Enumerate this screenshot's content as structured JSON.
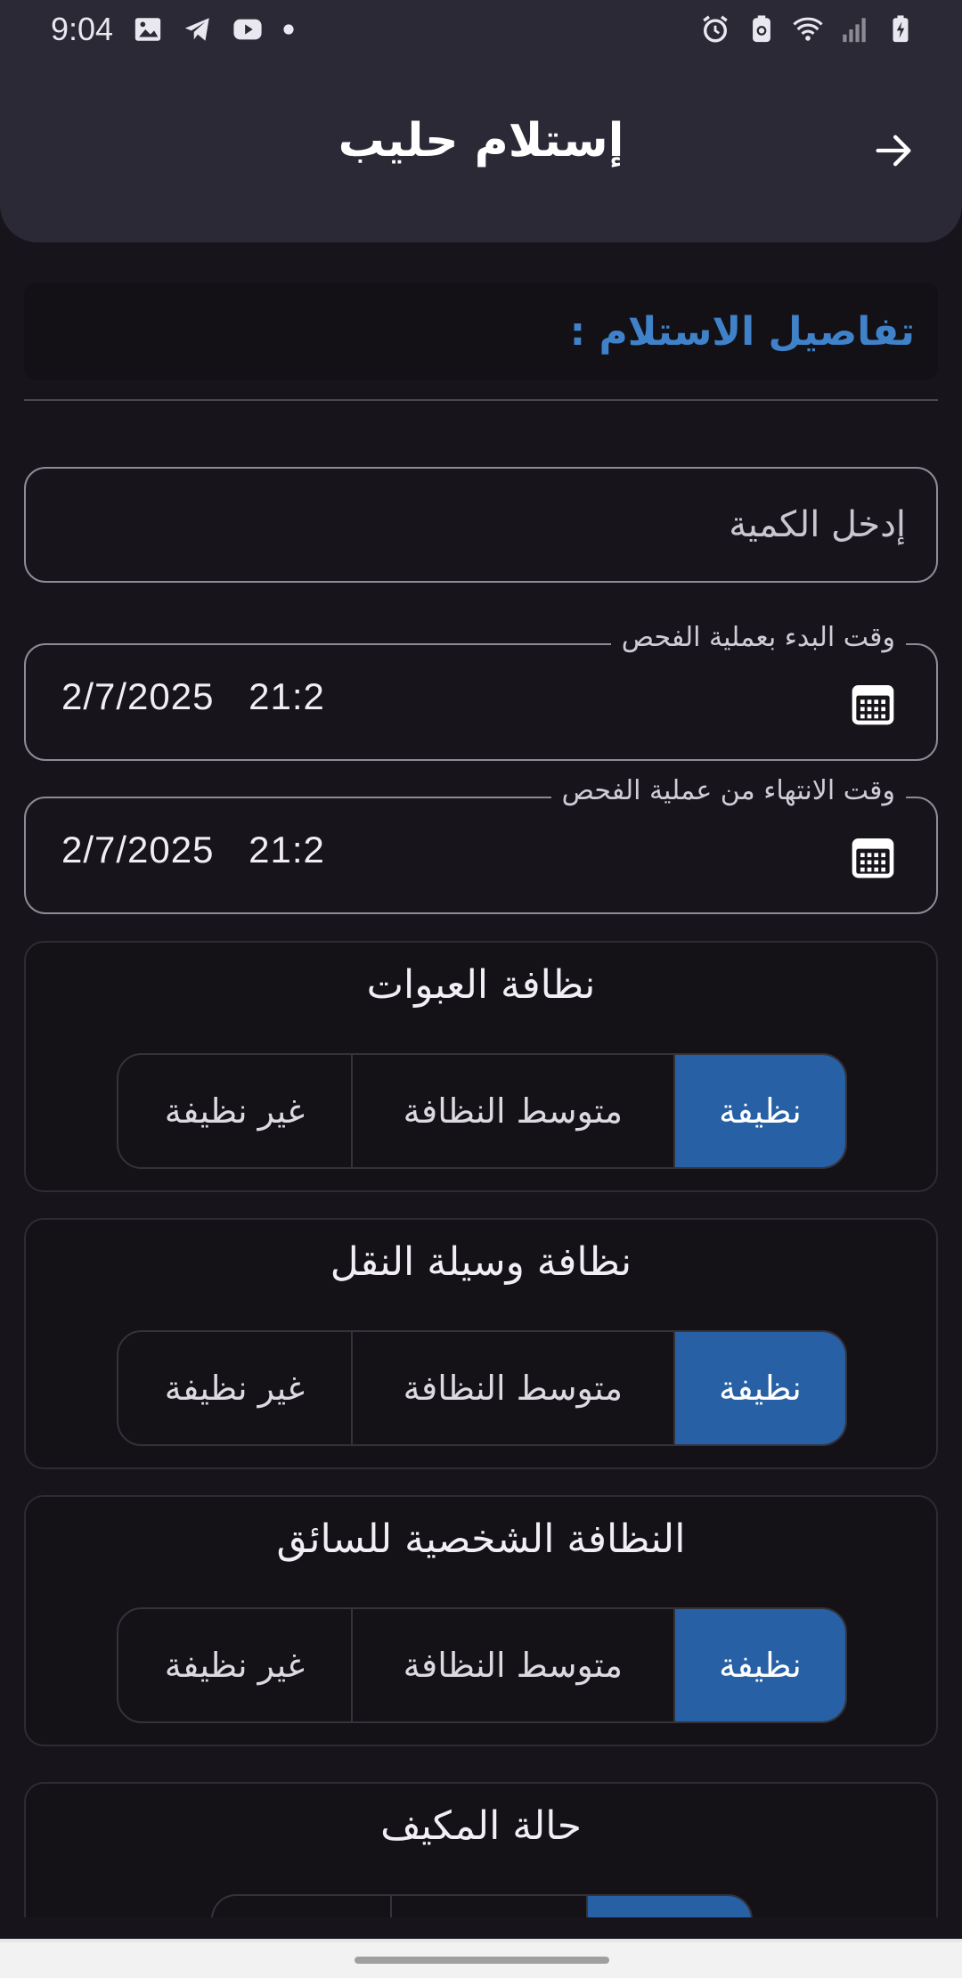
{
  "status_bar": {
    "time": "9:04",
    "left_icons": [
      "gallery-icon",
      "telegram-icon",
      "youtube-icon",
      "dot-icon"
    ],
    "right_icons": [
      "alarm-icon",
      "battery-saver-icon",
      "wifi-icon",
      "signal-icon",
      "battery-charging-icon"
    ]
  },
  "header": {
    "title": "إستلام حليب",
    "back_icon": "arrow-right-icon"
  },
  "section": {
    "title": "تفاصيل الاستلام :"
  },
  "quantity": {
    "placeholder": "إدخل الكمية"
  },
  "start_time": {
    "label": "وقت البدء بعملية الفحص",
    "value": "2/7/2025 21:2",
    "icon": "calendar-icon"
  },
  "end_time": {
    "label": "وقت الانتهاء من عملية الفحص",
    "value": "2/7/2025 21:2",
    "icon": "calendar-icon"
  },
  "cards": [
    {
      "title": "نظافة العبوات",
      "options": [
        "نظيفة",
        "متوسط النظافة",
        "غير نظيفة"
      ],
      "selected": "نظيفة"
    },
    {
      "title": "نظافة وسيلة النقل",
      "options": [
        "نظيفة",
        "متوسط النظافة",
        "غير نظيفة"
      ],
      "selected": "نظيفة"
    },
    {
      "title": "النظافة الشخصية للسائق",
      "options": [
        "نظيفة",
        "متوسط النظافة",
        "غير نظيفة"
      ],
      "selected": "نظيفة"
    },
    {
      "title": "حالة المكيف"
    }
  ],
  "colors": {
    "accent": "#2760a4",
    "section_title": "#3f82c9",
    "app_bar": "#2b2935",
    "background": "#17151b"
  }
}
